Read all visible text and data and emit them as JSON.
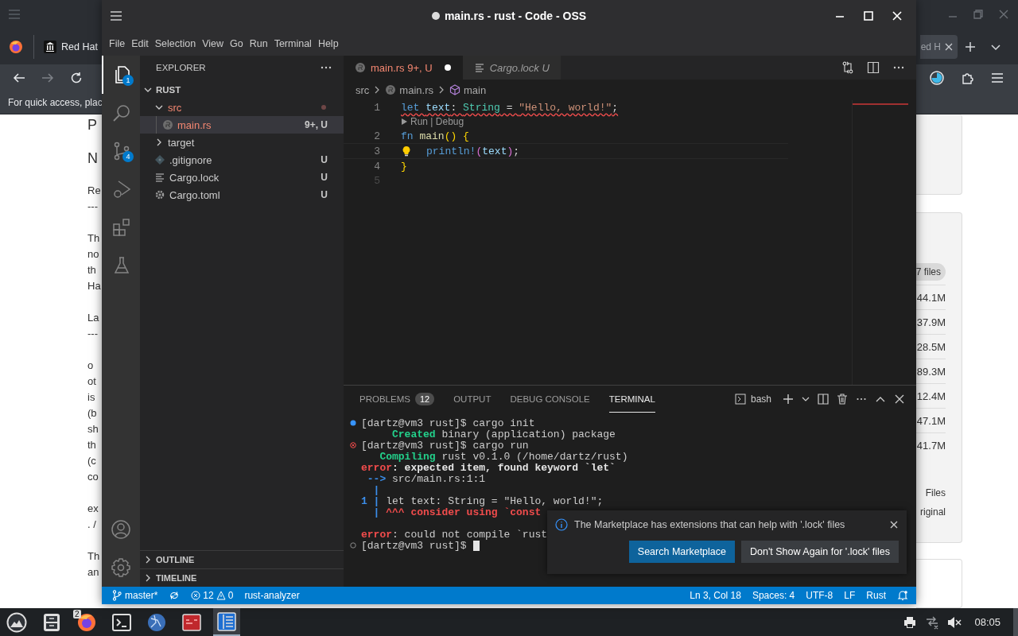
{
  "browser": {
    "tabs": [
      {
        "label": "Red Hat",
        "selected": false
      },
      {
        "label": "ed H",
        "selected": true
      }
    ],
    "bookmark_hint": "For quick access, plac",
    "page_left": [
      {
        "kind": "heading",
        "lines": [
          "P"
        ]
      },
      {
        "kind": "heading",
        "lines": [
          "N"
        ]
      },
      {
        "kind": "text",
        "lines": [
          "Re",
          "---"
        ]
      },
      {
        "kind": "text",
        "lines": [
          "Th",
          "no",
          "th",
          "Ha"
        ]
      },
      {
        "kind": "text",
        "lines": [
          "La",
          "---"
        ]
      },
      {
        "kind": "text",
        "lines": [
          "o",
          "ot",
          "is",
          "(b",
          "sh",
          "th",
          "(c",
          "co"
        ]
      },
      {
        "kind": "text",
        "lines": [
          "ex",
          ". /"
        ]
      },
      {
        "kind": "text",
        "lines": [
          "Th",
          "an"
        ]
      }
    ],
    "file_count": "7 files",
    "sizes": [
      "44.1M",
      "37.9M",
      "28.5M",
      "89.3M",
      "12.4M",
      "47.1M",
      "41.7M"
    ],
    "summary": [
      "Files",
      "riginal"
    ]
  },
  "vscode": {
    "title": "main.rs - rust - Code - OSS",
    "dirty": true,
    "menu": [
      "File",
      "Edit",
      "Selection",
      "View",
      "Go",
      "Run",
      "Terminal",
      "Help"
    ],
    "activity": [
      {
        "kind": "files",
        "badge": "1",
        "selected": true
      },
      {
        "kind": "search",
        "selected": false
      },
      {
        "kind": "scm",
        "badge": "4",
        "selected": false
      },
      {
        "kind": "debug",
        "selected": false
      },
      {
        "kind": "extensions",
        "selected": false
      },
      {
        "kind": "testing",
        "selected": false
      }
    ],
    "explorer": {
      "title": "EXPLORER",
      "root": "RUST",
      "expanded": true,
      "tree": [
        {
          "name": "src",
          "kind": "folder",
          "expanded": true,
          "error": true,
          "dot": true,
          "children": [
            {
              "name": "main.rs",
              "kind": "rust",
              "error": true,
              "selected": true,
              "decoration": "9+, U"
            }
          ]
        },
        {
          "name": "target",
          "kind": "folder",
          "expanded": false
        },
        {
          "name": ".gitignore",
          "kind": "git",
          "decoration": "U"
        },
        {
          "name": "Cargo.lock",
          "kind": "lines",
          "decoration": "U"
        },
        {
          "name": "Cargo.toml",
          "kind": "gear",
          "decoration": "U"
        }
      ],
      "sections": [
        {
          "label": "OUTLINE",
          "expanded": false
        },
        {
          "label": "TIMELINE",
          "expanded": false
        }
      ]
    },
    "tabs": [
      {
        "kind": "rust",
        "label": "main.rs",
        "decoration": "9+, U",
        "error": true,
        "dirty": true,
        "preview": false,
        "selected": true
      },
      {
        "kind": "lines",
        "label": "Cargo.lock",
        "decoration": "U",
        "error": false,
        "dirty": false,
        "preview": true,
        "selected": false
      }
    ],
    "breadcrumb": [
      {
        "kind": "folder",
        "label": "src"
      },
      {
        "kind": "rust",
        "label": "main.rs"
      },
      {
        "kind": "symbol",
        "label": "main"
      }
    ],
    "code": [
      {
        "number": "1",
        "error": true,
        "tokens": [
          {
            "kind": "keyword",
            "text": "let "
          },
          {
            "kind": "variable",
            "text": "text"
          },
          {
            "kind": "punctuation",
            "text": ": "
          },
          {
            "kind": "type",
            "text": "String"
          },
          {
            "kind": "punctuation",
            "text": " = "
          },
          {
            "kind": "string",
            "text": "\"Hello, world!\""
          },
          {
            "kind": "punctuation",
            "text": ";"
          }
        ]
      },
      {
        "number": "2",
        "codelens": "Run | Debug",
        "tokens": [
          {
            "kind": "keyword",
            "text": "fn "
          },
          {
            "kind": "function",
            "text": "main"
          },
          {
            "kind": "brace",
            "text": "() {"
          }
        ]
      },
      {
        "number": "3",
        "current": true,
        "lightbulb": true,
        "tokens": [
          {
            "kind": "macro",
            "text": "println!"
          },
          {
            "kind": "paren",
            "text": "("
          },
          {
            "kind": "variable",
            "text": "text"
          },
          {
            "kind": "paren",
            "text": ")"
          },
          {
            "kind": "punctuation",
            "text": ";"
          }
        ]
      },
      {
        "number": "4",
        "tokens": [
          {
            "kind": "brace",
            "text": "}"
          }
        ]
      },
      {
        "number": "5",
        "faint": true
      }
    ],
    "panel_tabs": [
      {
        "label": "PROBLEMS",
        "badge": "12",
        "selected": false
      },
      {
        "label": "OUTPUT",
        "selected": false
      },
      {
        "label": "DEBUG CONSOLE",
        "selected": false
      },
      {
        "label": "TERMINAL",
        "selected": true
      }
    ],
    "terminal_name": "bash",
    "terminal": [
      {
        "kind": "info",
        "segs": [
          {
            "kind": "plain",
            "text": "[dartz@vm3 rust]$ cargo init"
          }
        ]
      },
      {
        "segs": [
          {
            "kind": "green",
            "text": "     Created"
          },
          {
            "kind": "plain",
            "text": " binary (application) package"
          }
        ]
      },
      {
        "kind": "error",
        "segs": [
          {
            "kind": "plain",
            "text": "[dartz@vm3 rust]$ cargo run"
          }
        ]
      },
      {
        "segs": [
          {
            "kind": "green",
            "text": "   Compiling"
          },
          {
            "kind": "plain",
            "text": " rust v0.1.0 (/home/dartz/rust)"
          }
        ]
      },
      {
        "segs": [
          {
            "kind": "red",
            "text": "error"
          },
          {
            "kind": "bold",
            "text": ": expected item, found keyword `let`"
          }
        ]
      },
      {
        "segs": [
          {
            "kind": "blue",
            "text": " -->"
          },
          {
            "kind": "plain",
            "text": " src/main.rs:1:1"
          }
        ]
      },
      {
        "segs": [
          {
            "kind": "blue",
            "text": "  |"
          }
        ]
      },
      {
        "segs": [
          {
            "kind": "blue",
            "text": "1 |"
          },
          {
            "kind": "plain",
            "text": " let text: String = \"Hello, world!\";"
          }
        ]
      },
      {
        "segs": [
          {
            "kind": "blue",
            "text": "  |"
          },
          {
            "kind": "red",
            "text": " ^^^ consider using `const"
          }
        ]
      },
      {
        "spaced": true,
        "segs": [
          {
            "kind": "red",
            "text": "error"
          },
          {
            "kind": "plain",
            "text": ": could not compile `rust"
          }
        ]
      },
      {
        "kind": "idle",
        "cursor": true,
        "segs": [
          {
            "kind": "plain",
            "text": "[dartz@vm3 rust]$"
          }
        ]
      }
    ],
    "notification": {
      "message": "The Marketplace has extensions that can help with '.lock' files",
      "buttons": [
        {
          "label": "Search Marketplace",
          "primary": true
        },
        {
          "label": "Don't Show Again for '.lock' files",
          "primary": false
        }
      ]
    },
    "status_left": [
      {
        "kind": "branch",
        "label": "master*"
      },
      {
        "kind": "sync"
      },
      {
        "kind": "problems",
        "errors": "12",
        "warnings": "0"
      },
      {
        "kind": "text",
        "label": "rust-analyzer"
      }
    ],
    "status_right": [
      "Ln 3, Col 18",
      "Spaces: 4",
      "UTF-8",
      "LF",
      "Rust"
    ]
  },
  "taskbar": {
    "apps": [
      {
        "kind": "mountain",
        "selected": false
      },
      {
        "kind": "cabinet",
        "selected": false
      },
      {
        "kind": "firefox",
        "badge": "2",
        "selected": false
      },
      {
        "kind": "terminal",
        "selected": false
      },
      {
        "kind": "globe",
        "selected": false
      },
      {
        "kind": "redapp",
        "selected": false
      },
      {
        "kind": "notes",
        "selected": true
      }
    ],
    "clock": "08:05"
  }
}
